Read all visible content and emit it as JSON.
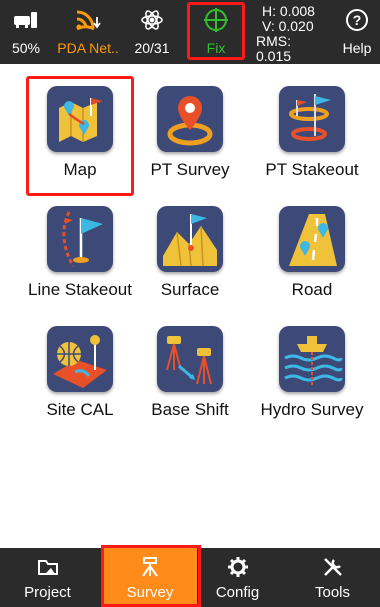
{
  "status_bar": {
    "battery_label": "50%",
    "network_label": "PDA Net..",
    "satellite_label": "20/31",
    "fix_label": "Fix",
    "metrics": {
      "h": "H: 0.008",
      "v": "V: 0.020",
      "rms": "RMS: 0.015"
    },
    "help_label": "Help",
    "icons": [
      "battery-icon",
      "signal-icon",
      "satellite-icon",
      "crosshair-icon",
      "help-icon"
    ],
    "colors": {
      "network": "#ff9900",
      "fix": "#2fbf2f",
      "bar": "#2b2b2b"
    }
  },
  "tiles": [
    {
      "label": "Map",
      "icon": "map-icon"
    },
    {
      "label": "PT Survey",
      "icon": "pin-survey-icon"
    },
    {
      "label": "PT Stakeout",
      "icon": "stakeout-icon"
    },
    {
      "label": "Line Stakeout",
      "icon": "line-stakeout-icon"
    },
    {
      "label": "Surface",
      "icon": "surface-icon"
    },
    {
      "label": "Road",
      "icon": "road-icon"
    },
    {
      "label": "Site CAL",
      "icon": "site-cal-icon"
    },
    {
      "label": "Base Shift",
      "icon": "base-shift-icon"
    },
    {
      "label": "Hydro Survey",
      "icon": "hydro-survey-icon"
    }
  ],
  "bottom_nav": {
    "items": [
      {
        "label": "Project",
        "icon": "folder-icon"
      },
      {
        "label": "Survey",
        "icon": "survey-icon"
      },
      {
        "label": "Config",
        "icon": "gear-icon"
      },
      {
        "label": "Tools",
        "icon": "tools-icon"
      }
    ],
    "active": "Survey",
    "colors": {
      "active": "#ff8c1a"
    }
  }
}
